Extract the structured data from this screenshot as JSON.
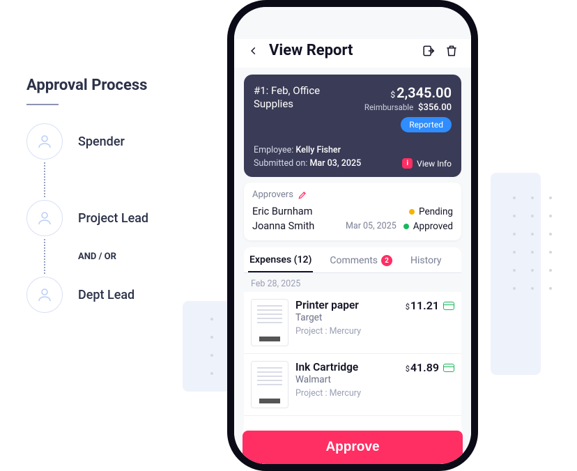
{
  "process": {
    "title": "Approval Process",
    "roles": [
      "Spender",
      "Project Lead",
      "Dept Lead"
    ],
    "and_or": "AND / OR"
  },
  "header": {
    "title": "View Report"
  },
  "summary": {
    "name": "#1: Feb, Office Supplies",
    "total": "2,345.00",
    "reimbursable_label": "Reimbursable",
    "reimbursable": "356.00",
    "status": "Reported",
    "employee_label": "Employee:",
    "employee": "Kelly Fisher",
    "submitted_label": "Submitted on:",
    "submitted": "Mar 03, 2025",
    "view_info": "View Info",
    "info_badge": "i"
  },
  "approvers": {
    "heading": "Approvers",
    "rows": [
      {
        "name": "Eric Burnham",
        "date": "",
        "status": "Pending",
        "dot": "amber"
      },
      {
        "name": "Joanna Smith",
        "date": "Mar 05, 2025",
        "status": "Approved",
        "dot": "green"
      }
    ]
  },
  "tabs": {
    "expenses": "Expenses (12)",
    "comments": "Comments",
    "comments_badge": "2",
    "history": "History"
  },
  "list": {
    "group_date": "Feb 28, 2025",
    "items": [
      {
        "title": "Printer paper",
        "merchant": "Target",
        "project_label": "Project :",
        "project": "Mercury",
        "amount": "11.21"
      },
      {
        "title": "Ink Cartridge",
        "merchant": "Walmart",
        "project_label": "Project :",
        "project": "Mercury",
        "amount": "41.89"
      }
    ]
  },
  "approve": {
    "label": "Approve"
  }
}
